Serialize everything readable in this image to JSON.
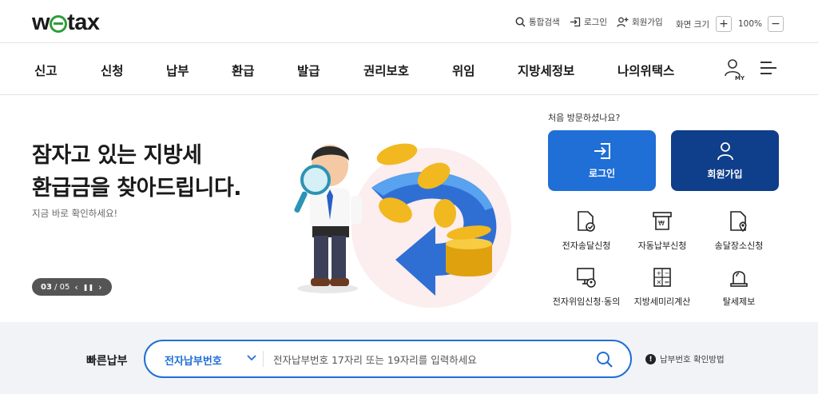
{
  "brand": {
    "logo_text_pre": "w",
    "logo_text_post": "tax",
    "accent": "#2e9e3c"
  },
  "utility": {
    "search_label": "통합검색",
    "login_label": "로그인",
    "join_label": "회원가입",
    "zoom_label": "화면 크기",
    "zoom_in": "+",
    "zoom_value": "100%",
    "zoom_out": "−"
  },
  "nav": {
    "items": [
      "신고",
      "신청",
      "납부",
      "환급",
      "발급",
      "권리보호",
      "위임",
      "지방세정보",
      "나의위택스"
    ],
    "my_label": "MY"
  },
  "hero": {
    "title_line1": "잠자고 있는 지방세",
    "title_line2": "환급금을 찾아드립니다.",
    "subtitle": "지금 바로 확인하세요!",
    "pager_current": "03",
    "pager_sep": " / ",
    "pager_total": "05",
    "prev": "‹",
    "pause": "❚❚",
    "next": "›"
  },
  "quick": {
    "first_visit": "처음 방문하셨나요?",
    "login_button": "로그인",
    "join_button": "회원가입",
    "services": [
      {
        "label": "전자송달신청",
        "icon": "document-check-icon"
      },
      {
        "label": "자동납부신청",
        "icon": "auto-pay-icon"
      },
      {
        "label": "송달장소신청",
        "icon": "location-document-icon"
      },
      {
        "label": "전자위임신청·동의",
        "icon": "monitor-delegate-icon"
      },
      {
        "label": "지방세미리계산",
        "icon": "calculator-icon"
      },
      {
        "label": "탈세제보",
        "icon": "siren-icon"
      }
    ],
    "colors": {
      "login": "#1f6fd6",
      "join": "#0f3e8a"
    }
  },
  "fastpay": {
    "label": "빠른납부",
    "select_value": "전자납부번호",
    "placeholder": "전자납부번호 17자리 또는 19자리를 입력하세요",
    "help": "납부번호 확인방법"
  }
}
